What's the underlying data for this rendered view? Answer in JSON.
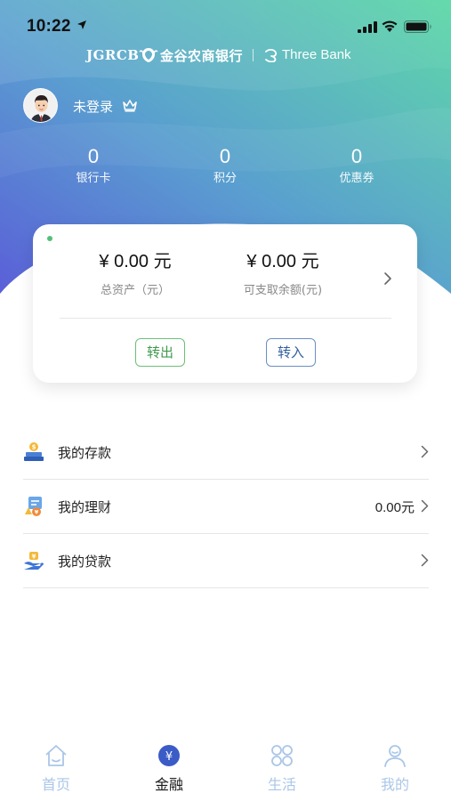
{
  "status_bar": {
    "time": "10:22"
  },
  "brand": {
    "abbr": "JGRCB",
    "name_cn": "金谷农商银行",
    "name_en": "Three Bank"
  },
  "user": {
    "name": "未登录"
  },
  "stats": [
    {
      "value": "0",
      "label": "银行卡"
    },
    {
      "value": "0",
      "label": "积分"
    },
    {
      "value": "0",
      "label": "优惠券"
    }
  ],
  "assets": {
    "total_value": "¥ 0.00 元",
    "total_label": "总资产（元）",
    "available_value": "¥ 0.00 元",
    "available_label": "可支取余额(元)",
    "transfer_out": "转出",
    "transfer_in": "转入"
  },
  "menu": [
    {
      "label": "我的存款",
      "value": "",
      "icon": "deposit-icon"
    },
    {
      "label": "我的理财",
      "value": "0.00元",
      "icon": "wealth-icon"
    },
    {
      "label": "我的贷款",
      "value": "",
      "icon": "loan-icon"
    }
  ],
  "tabs": [
    {
      "label": "首页",
      "icon": "home-icon",
      "active": false
    },
    {
      "label": "金融",
      "icon": "yuan-icon",
      "active": true
    },
    {
      "label": "生活",
      "icon": "grid-icon",
      "active": false
    },
    {
      "label": "我的",
      "icon": "profile-icon",
      "active": false
    }
  ],
  "colors": {
    "gradient_left": "#5b6fd6",
    "gradient_right": "#5fd0a8",
    "accent_green": "#3e9a4d",
    "accent_blue": "#325f9f",
    "tab_active_icon": "#3b5bc6",
    "tab_inactive": "#aac6e8"
  }
}
